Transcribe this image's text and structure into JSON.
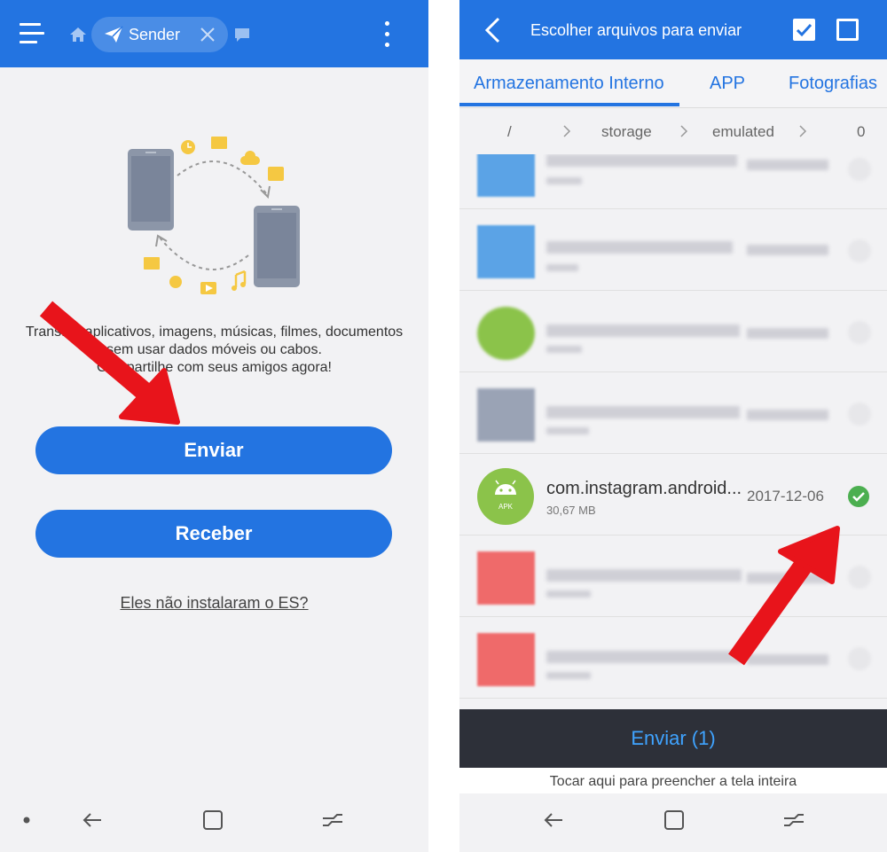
{
  "left": {
    "chip_label": "Sender",
    "description_lines": [
      "Transfira aplicativos, imagens, músicas, filmes, documentos",
      "sem usar dados móveis ou cabos.",
      "Compartilhe com seus amigos agora!"
    ],
    "send_label": "Enviar",
    "receive_label": "Receber",
    "install_link": "Eles não instalaram o ES?"
  },
  "right": {
    "title": "Escolher arquivos para enviar",
    "tabs": [
      "Armazenamento Interno",
      "APP",
      "Fotografias"
    ],
    "breadcrumb": [
      "/",
      "storage",
      "emulated",
      "0"
    ],
    "selected_file": {
      "name": "com.instagram.android...",
      "size": "30,67 MB",
      "date": "2017-12-06",
      "badge": "APK"
    },
    "send_button_label": "Enviar (1)",
    "fill_hint": "Tocar aqui para preencher a tela inteira"
  },
  "colors": {
    "accent": "#2374e1",
    "dark_bar": "#2d3039",
    "send_text": "#3fa3ff",
    "apk_green": "#8bc34a",
    "check_green": "#4caf50",
    "arrow_red": "#e8141b"
  },
  "icons": {
    "left_topbar": [
      "menu-icon",
      "home-icon",
      "paper-plane-icon",
      "close-icon",
      "chat-bubble-icon",
      "more-vert-icon"
    ],
    "right_topbar": [
      "back-icon",
      "select-all-checkbox-icon",
      "box-select-icon"
    ],
    "nav": [
      "back-nav-icon",
      "recents-nav-icon",
      "home-nav-icon"
    ]
  }
}
